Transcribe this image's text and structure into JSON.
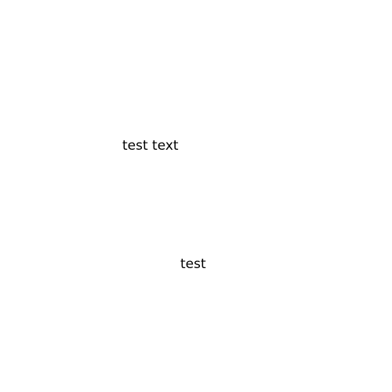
{
  "labels": {
    "upper": "test text",
    "lower": "test"
  },
  "colors": {
    "background": "#ffffff",
    "text": "#000000"
  }
}
